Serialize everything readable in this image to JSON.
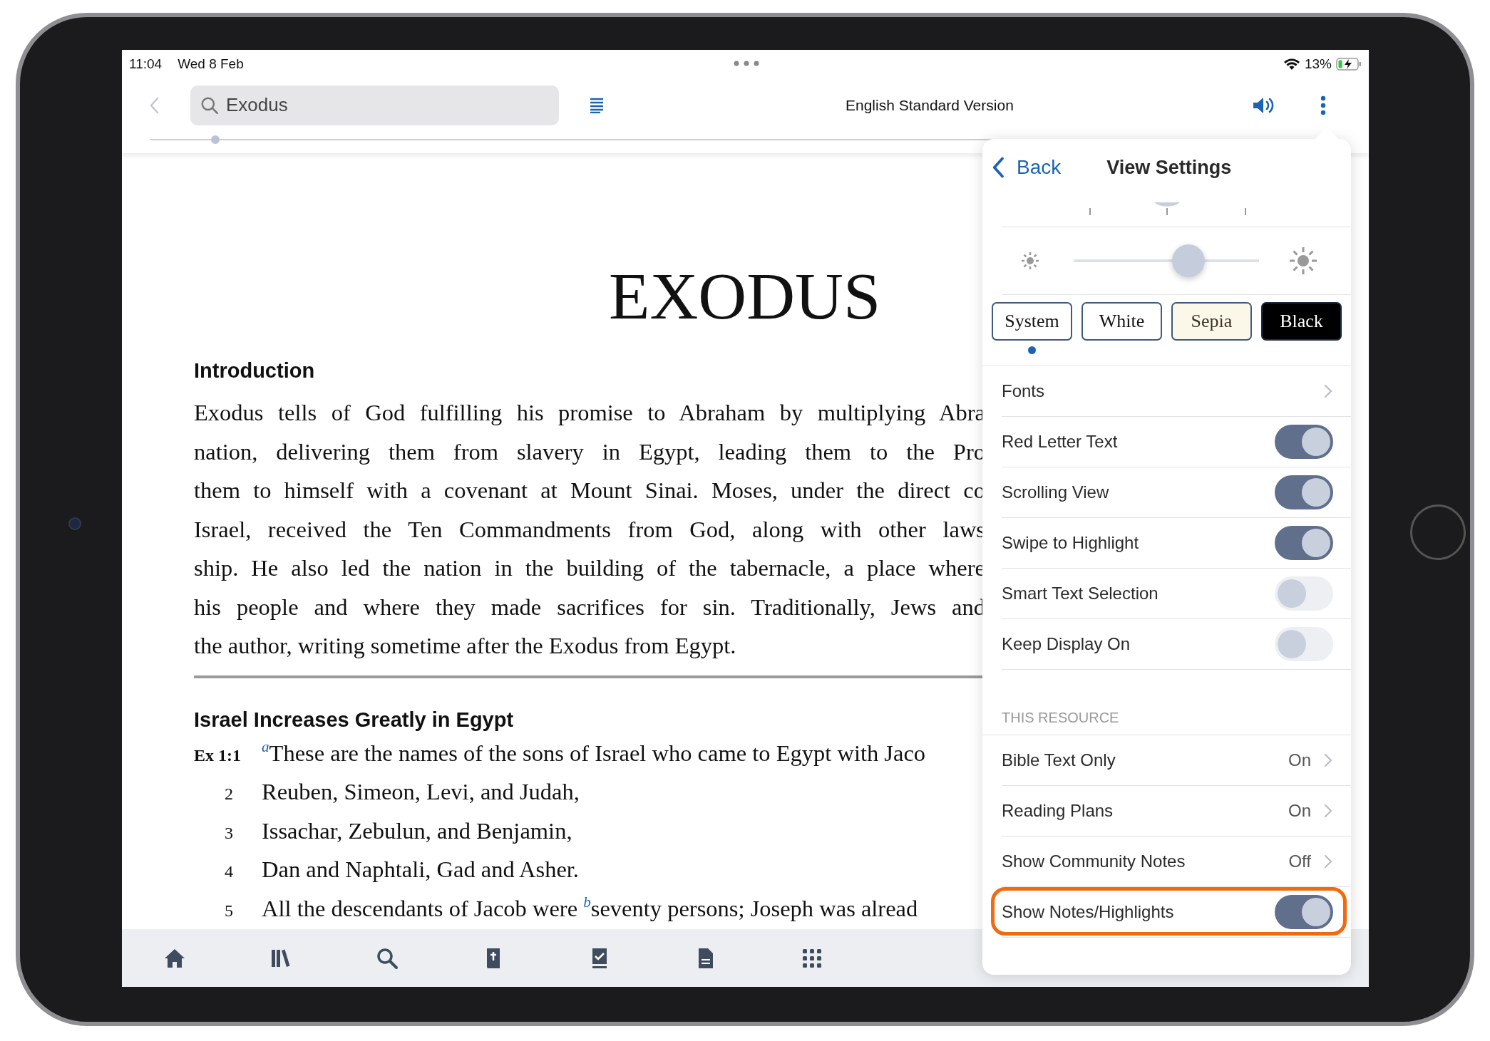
{
  "status_bar": {
    "time": "11:04",
    "date": "Wed 8 Feb",
    "battery": "13%"
  },
  "toolbar": {
    "search": {
      "value": "Exodus"
    },
    "title": "English Standard Version"
  },
  "reader": {
    "book_title": "EXODUS",
    "intro_heading": "Introduction",
    "intro_lines": [
      "Exodus tells of God fulfilling his promise to Abraham by multiplying Abra",
      "nation, delivering them from slavery in Egypt, leading them to the Pro",
      "them to himself with a covenant at Mount Sinai. Moses, under the direct co",
      "Israel, received the Ten Commandments from God, along with other laws",
      "ship. He also led the nation in the building of the tabernacle, a place where",
      "his people and where they made sacrifices for sin. Traditionally, Jews and",
      "the author, writing sometime after the Exodus from Egypt."
    ],
    "section_heading": "Israel Increases Greatly in Egypt",
    "verses": [
      {
        "kind": "reference",
        "number": "Ex 1:1",
        "text": "$^{a}$These are the names of the sons of Israel who came to Egypt with Jaco"
      },
      {
        "kind": "number",
        "number": "2",
        "text": "Reuben, Simeon, Levi, and Judah,"
      },
      {
        "kind": "number",
        "number": "3",
        "text": "Issachar, Zebulun, and Benjamin,"
      },
      {
        "kind": "number",
        "number": "4",
        "text": "Dan and Naphtali, Gad and Asher."
      },
      {
        "kind": "number",
        "number": "5",
        "text": "All the descendants of Jacob were $^{b}$seventy persons; Joseph was alread"
      }
    ]
  },
  "settings": {
    "back": "Back",
    "title": "View Settings",
    "brightness": {
      "level": 0.62
    },
    "themes": [
      {
        "kind": "system",
        "label": "System",
        "selected": true
      },
      {
        "kind": "white",
        "label": "White",
        "selected": false
      },
      {
        "kind": "sepia",
        "label": "Sepia",
        "selected": false
      },
      {
        "kind": "black",
        "label": "Black",
        "selected": false
      }
    ],
    "rows": [
      {
        "kind": "link",
        "label": "Fonts"
      },
      {
        "kind": "toggle",
        "label": "Red Letter Text",
        "on": true
      },
      {
        "kind": "toggle",
        "label": "Scrolling View",
        "on": true
      },
      {
        "kind": "toggle",
        "label": "Swipe to Highlight",
        "on": true
      },
      {
        "kind": "toggle",
        "label": "Smart Text Selection",
        "on": false
      },
      {
        "kind": "toggle",
        "label": "Keep Display On",
        "on": false
      }
    ],
    "section_header": "THIS RESOURCE",
    "resource_rows": [
      {
        "kind": "link",
        "label": "Bible Text Only",
        "value": "On",
        "highlighted": false
      },
      {
        "kind": "link",
        "label": "Reading Plans",
        "value": "On",
        "highlighted": false
      },
      {
        "kind": "link",
        "label": "Show Community Notes",
        "value": "Off",
        "highlighted": false
      },
      {
        "kind": "toggle",
        "label": "Show Notes/Highlights",
        "on": true,
        "highlighted": true
      }
    ]
  }
}
